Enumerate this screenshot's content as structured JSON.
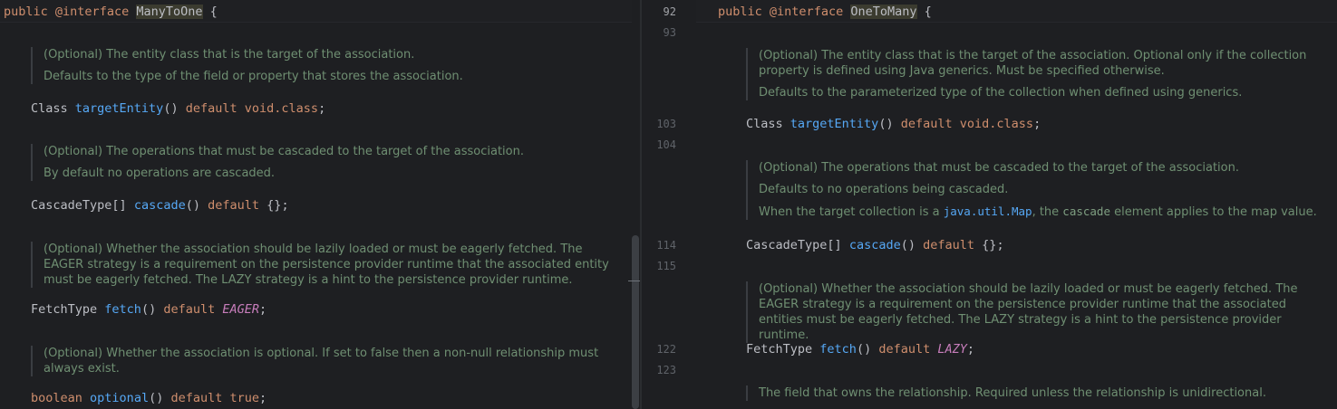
{
  "left": {
    "header": {
      "public": "public",
      "annotation": "@interface",
      "name": "ManyToOne",
      "brace": "{"
    },
    "blocks": [
      {
        "doc": [
          "(Optional) The entity class that is the target of the association.",
          "Defaults to the type of the field or property that stores the association."
        ],
        "code": {
          "type": "Class",
          "method": "targetEntity",
          "parens": "()",
          "default": "default",
          "value": "void.class",
          "end": ";"
        }
      },
      {
        "doc": [
          "(Optional) The operations that must be cascaded to the target of the association.",
          "By default no operations are cascaded."
        ],
        "code": {
          "type": "CascadeType[]",
          "method": "cascade",
          "parens": "()",
          "default": "default",
          "value": "{}",
          "end": ";"
        }
      },
      {
        "doc": [
          "(Optional) Whether the association should be lazily loaded or must be eagerly fetched. The EAGER strategy is a requirement on the persistence provider runtime that the associated entity must be eagerly fetched. The LAZY strategy is a hint to the persistence provider runtime."
        ],
        "code": {
          "type": "FetchType",
          "method": "fetch",
          "parens": "()",
          "default": "default",
          "value": "EAGER",
          "end": ";"
        }
      },
      {
        "doc": [
          "(Optional) Whether the association is optional. If set to false then a non-null relationship must always exist."
        ],
        "code": {
          "type": "boolean",
          "method": "optional",
          "parens": "()",
          "default": "default",
          "value": "true",
          "end": ";"
        }
      }
    ]
  },
  "right": {
    "header": {
      "public": "public",
      "annotation": "@interface",
      "name": "OneToMany",
      "brace": "{"
    },
    "line_numbers": [
      "92",
      "93",
      "103",
      "104",
      "114",
      "115",
      "122",
      "123"
    ],
    "blocks": [
      {
        "doc": [
          "(Optional) The entity class that is the target of the association. Optional only if the collection property is defined using Java generics. Must be specified otherwise.",
          "Defaults to the parameterized type of the collection when defined using generics."
        ],
        "code": {
          "type": "Class",
          "method": "targetEntity",
          "parens": "()",
          "default": "default",
          "value": "void.class",
          "end": ";"
        }
      },
      {
        "doc": [
          "(Optional) The operations that must be cascaded to the target of the association.",
          "Defaults to no operations being cascaded."
        ],
        "doc_extra": {
          "prefix": "When the target collection is a ",
          "code1": "java.util.Map",
          "mid": ", the ",
          "code2": "cascade",
          "suffix": " element applies to the map value."
        },
        "code": {
          "type": "CascadeType[]",
          "method": "cascade",
          "parens": "()",
          "default": "default",
          "value": "{}",
          "end": ";"
        }
      },
      {
        "doc": [
          "(Optional) Whether the association should be lazily loaded or must be eagerly fetched. The EAGER strategy is a requirement on the persistence provider runtime that the associated entities must be eagerly fetched. The LAZY strategy is a hint to the persistence provider runtime."
        ],
        "code": {
          "type": "FetchType",
          "method": "fetch",
          "parens": "()",
          "default": "default",
          "value": "LAZY",
          "end": ";"
        }
      },
      {
        "doc": [
          "The field that owns the relationship. Required unless the relationship is unidirectional."
        ]
      }
    ]
  }
}
